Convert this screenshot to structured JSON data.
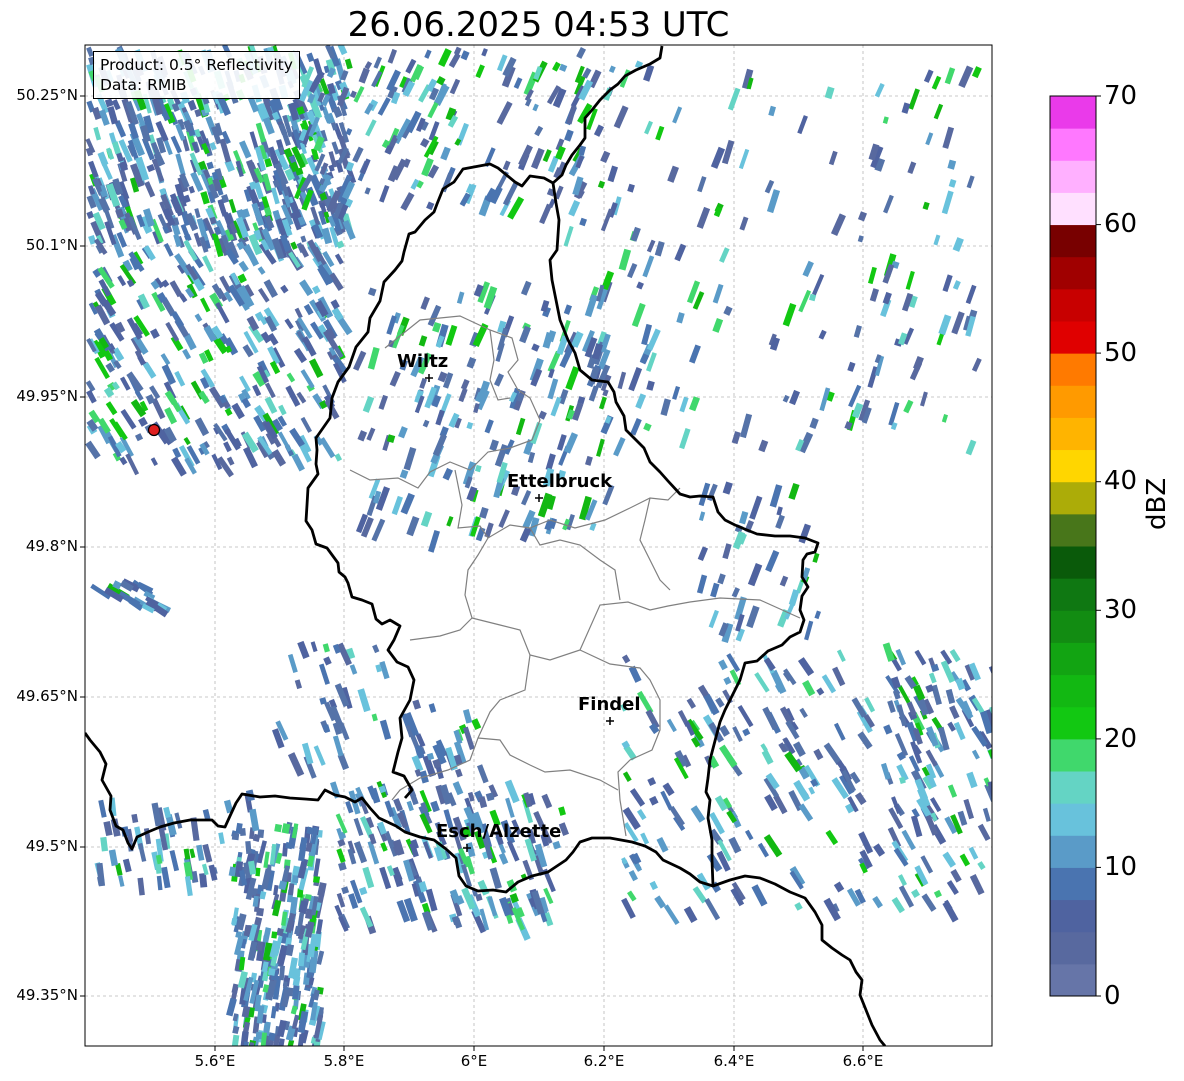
{
  "title": "26.06.2025 04:53 UTC",
  "info": {
    "product": "Product: 0.5° Reflectivity",
    "data": "Data: RMIB"
  },
  "lat_labels": [
    "50.25°N",
    "50.1°N",
    "49.95°N",
    "49.8°N",
    "49.65°N",
    "49.5°N",
    "49.35°N"
  ],
  "lon_labels": [
    "5.6°E",
    "5.8°E",
    "6°E",
    "6.2°E",
    "6.4°E",
    "6.6°E"
  ],
  "cities": [
    {
      "name": "Wiltz"
    },
    {
      "name": "Ettelbruck"
    },
    {
      "name": "Findel"
    },
    {
      "name": "Esch/Alzette"
    }
  ],
  "colorbar": {
    "label": "dBZ",
    "ticks": [
      "0",
      "10",
      "20",
      "30",
      "40",
      "50",
      "60",
      "70"
    ],
    "colors": [
      "#6675a8",
      "#58699f",
      "#4f63a0",
      "#4a74b0",
      "#5a9bc8",
      "#68c2dc",
      "#64d4c4",
      "#40d86c",
      "#12c812",
      "#12b812",
      "#12a412",
      "#128c12",
      "#0f7812",
      "#0a5a0a",
      "#48761a",
      "#acac08",
      "#ffd600",
      "#ffb400",
      "#ff9a00",
      "#ff7a00",
      "#e00000",
      "#c80000",
      "#a00000",
      "#780000",
      "#ffe0ff",
      "#ffb0ff",
      "#ff78ff",
      "#ea3aea"
    ]
  },
  "radar_site_color": "#e02020"
}
